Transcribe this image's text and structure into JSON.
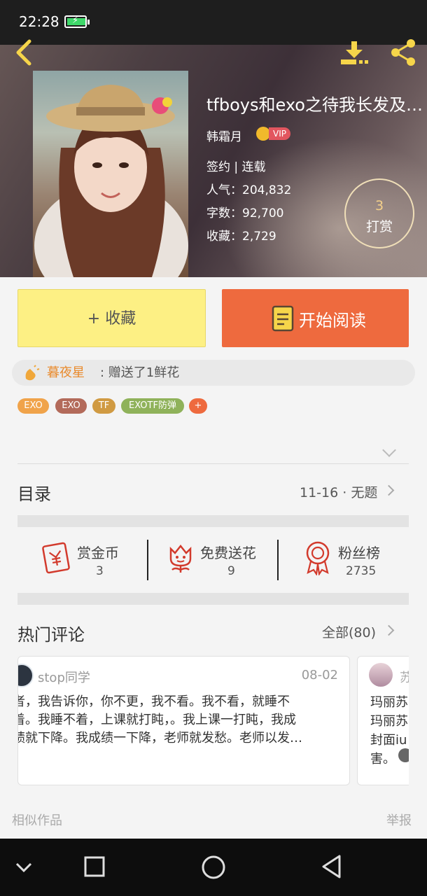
{
  "status_bar": {
    "time": "22:28"
  },
  "book": {
    "title": "tfboys和exo之待我长发及…",
    "author": "韩霜月",
    "vip_badge": "VIP",
    "status": "签约 | 连载",
    "popularity": "人气：204,832",
    "word_count": "字数：92,700",
    "favorites": "收藏：2,729",
    "reward_count": "3",
    "reward_label": "打赏"
  },
  "actions": {
    "collect_label": "+ 收藏",
    "read_label": "开始阅读"
  },
  "gift_notice": {
    "name": "暮夜星",
    "text": ": 赠送了1鲜花"
  },
  "tags": [
    {
      "label": "EXO",
      "color": "#f0a34a"
    },
    {
      "label": "EXO",
      "color": "#b36a5a"
    },
    {
      "label": "TF",
      "color": "#d09a42"
    },
    {
      "label": "EXOTF防弹",
      "color": "#8fb25a"
    },
    {
      "label": "+",
      "color": "#ee6a3e"
    }
  ],
  "catalog": {
    "title": "目录",
    "latest": "11-16 · 无题"
  },
  "metrics": [
    {
      "label": "赏金币",
      "value": "3",
      "icon": "coin-envelope-icon"
    },
    {
      "label": "免费送花",
      "value": "9",
      "icon": "flower-icon"
    },
    {
      "label": "粉丝榜",
      "value": "2735",
      "icon": "medal-icon"
    }
  ],
  "comments": {
    "title": "热门评论",
    "all_label": "全部(80)",
    "items": [
      {
        "user": "stop同学",
        "date": "08-02",
        "text": "者，我告诉你，你不更，我不看。我不看，就睡不\n着。我睡不着，上课就打盹，。我上课一打盹，我成\n绩就下降。我成绩一下降，老师就发愁。老师以发…"
      },
      {
        "user": "苏",
        "date": "",
        "text": "玛丽苏\n玛丽苏\n封面iu\n害。"
      }
    ]
  },
  "footer": {
    "similar": "相似作品",
    "report": "举报"
  },
  "colors": {
    "accent": "#ee6a3e",
    "collect_bg": "#fdf084",
    "gift_name": "#e98a2c"
  }
}
